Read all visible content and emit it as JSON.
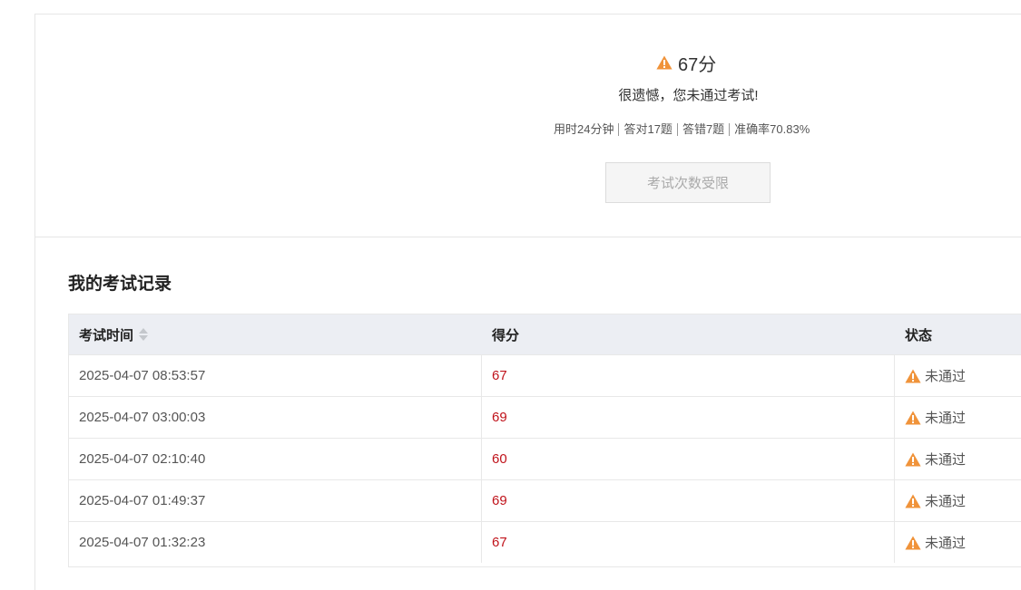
{
  "result": {
    "score": "67分",
    "message": "很遗憾，您未通过考试!",
    "stats": [
      "用时24分钟",
      "答对17题",
      "答错7题",
      "准确率70.83%"
    ],
    "button_label": "考试次数受限",
    "warn_color": "#f0933a"
  },
  "records": {
    "title": "我的考试记录",
    "headers": {
      "time": "考试时间",
      "score": "得分",
      "status": "状态"
    },
    "rows": [
      {
        "time": "2025-04-07 08:53:57",
        "score": "67",
        "status": "未通过"
      },
      {
        "time": "2025-04-07 03:00:03",
        "score": "69",
        "status": "未通过"
      },
      {
        "time": "2025-04-07 02:10:40",
        "score": "60",
        "status": "未通过"
      },
      {
        "time": "2025-04-07 01:49:37",
        "score": "69",
        "status": "未通过"
      },
      {
        "time": "2025-04-07 01:32:23",
        "score": "67",
        "status": "未通过"
      }
    ]
  }
}
